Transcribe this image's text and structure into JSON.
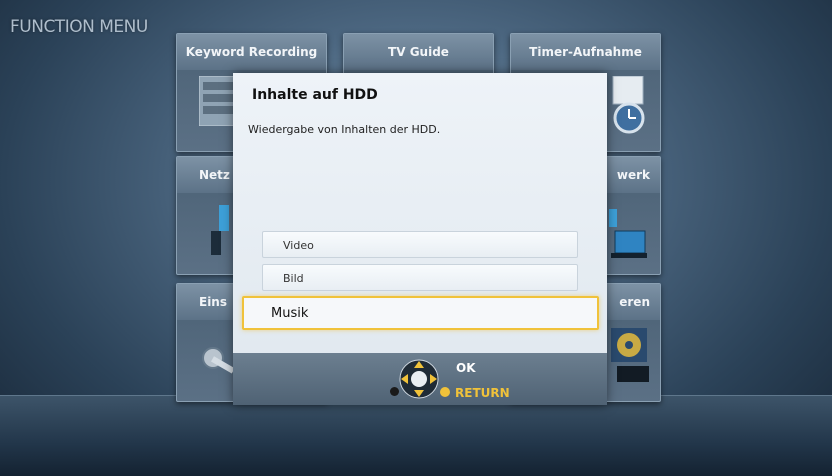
{
  "menu_title": "FUNCTION MENU",
  "tiles": {
    "keyword_recording": "Keyword Recording",
    "tv_guide": "TV Guide",
    "timer_recording": "Timer-Aufnahme",
    "network_left": "Netz",
    "network_right": "werk",
    "settings_left": "Eins",
    "copy_right": "eren"
  },
  "dialog": {
    "title": "Inhalte auf HDD",
    "description": "Wiedergabe von Inhalten der HDD.",
    "options": [
      "Video",
      "Bild",
      "Musik"
    ],
    "selected": "Musik"
  },
  "footer": {
    "ok_label": "OK",
    "return_label": "RETURN"
  },
  "colors": {
    "highlight": "#f0c23a",
    "return_color": "#f0c23a"
  }
}
